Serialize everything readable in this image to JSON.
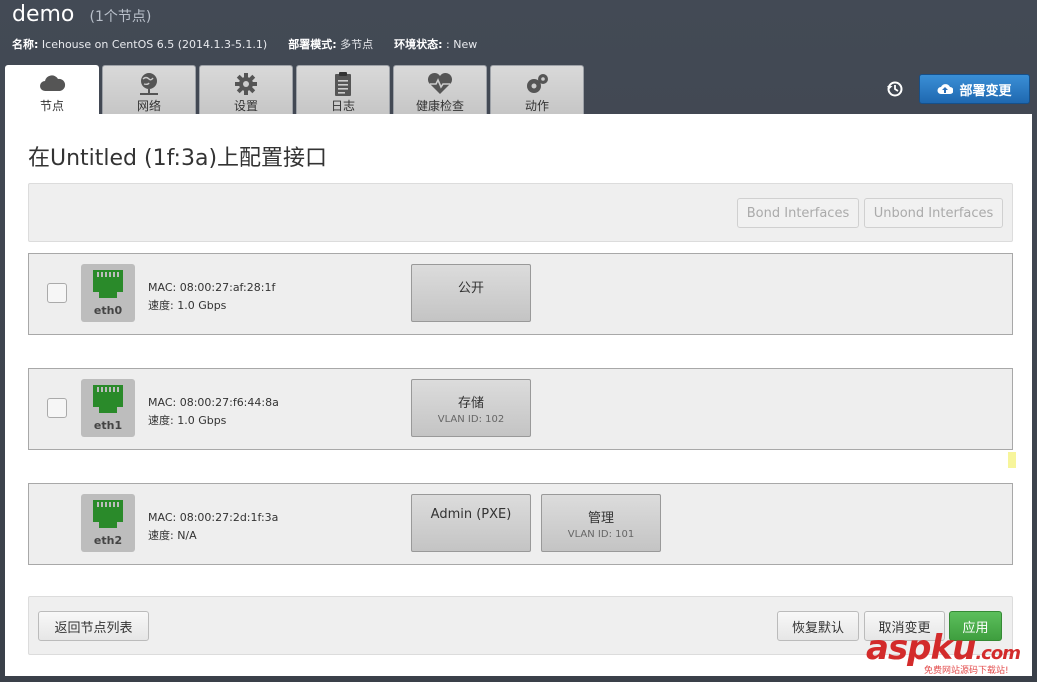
{
  "header": {
    "env_name": "demo",
    "node_count": "(1个节点)",
    "name_label": "名称:",
    "name_value": "Icehouse on CentOS 6.5 (2014.1.3-5.1.1)",
    "mode_label": "部署模式:",
    "mode_value": "多节点",
    "status_label": "环境状态:",
    "status_value": ": New"
  },
  "tabs": [
    {
      "label": "节点",
      "icon": "cloud-icon",
      "active": true
    },
    {
      "label": "网络",
      "icon": "network-globe-icon"
    },
    {
      "label": "设置",
      "icon": "gear-icon"
    },
    {
      "label": "日志",
      "icon": "clipboard-icon"
    },
    {
      "label": "健康检查",
      "icon": "heart-pulse-icon"
    },
    {
      "label": "动作",
      "icon": "cogs-icon"
    }
  ],
  "toolbar": {
    "history_icon": "history-icon",
    "deploy_label": "部署变更",
    "deploy_icon": "cloud-upload-icon"
  },
  "page": {
    "title": "在Untitled (1f:3a)上配置接口"
  },
  "bond_bar": {
    "bond_label": "Bond Interfaces",
    "unbond_label": "Unbond Interfaces"
  },
  "interfaces": [
    {
      "name": "eth0",
      "mac": "MAC: 08:00:27:af:28:1f",
      "speed": "速度: 1.0 Gbps",
      "has_checkbox": true,
      "networks": [
        {
          "name": "公开",
          "vlan": ""
        }
      ]
    },
    {
      "name": "eth1",
      "mac": "MAC: 08:00:27:f6:44:8a",
      "speed": "速度: 1.0 Gbps",
      "has_checkbox": true,
      "networks": [
        {
          "name": "存储",
          "vlan": "VLAN ID: 102"
        }
      ]
    },
    {
      "name": "eth2",
      "mac": "MAC: 08:00:27:2d:1f:3a",
      "speed": "速度: N/A",
      "has_checkbox": false,
      "networks": [
        {
          "name": "Admin (PXE)",
          "vlan": ""
        },
        {
          "name": "管理",
          "vlan": "VLAN ID: 101"
        }
      ]
    }
  ],
  "footer": {
    "back_label": "返回节点列表",
    "defaults_label": "恢复默认",
    "cancel_label": "取消变更",
    "apply_label": "应用"
  },
  "watermark": {
    "brand": "aspku",
    "tld": ".com",
    "tagline": "免费网站源码下载站!"
  },
  "colors": {
    "accent_blue": "#2a7cc7",
    "success_green": "#47a447",
    "port_green": "#2a8a2a",
    "background_dark": "#3c424c"
  }
}
